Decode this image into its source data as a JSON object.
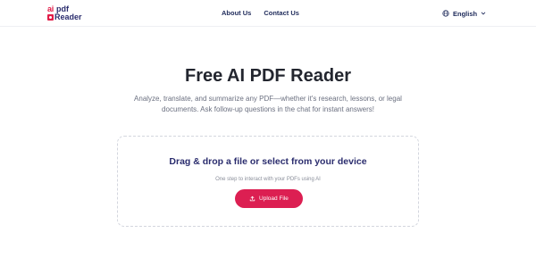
{
  "header": {
    "logo": {
      "ai": "ai",
      "pdf": "pdf",
      "reader": "Reader"
    },
    "nav": [
      {
        "label": "About Us"
      },
      {
        "label": "Contact Us"
      }
    ],
    "language": {
      "label": "English",
      "icon": "globe-icon",
      "chevron": "chevron-down-icon"
    }
  },
  "hero": {
    "title": "Free AI PDF Reader",
    "subtitle": "Analyze, translate, and summarize any PDF—whether it's research, lessons, or legal documents. Ask follow-up questions in the chat for instant answers!"
  },
  "dropzone": {
    "title": "Drag & drop a file or select from your device",
    "subtitle": "One step to interact with your PDFs using AI",
    "button_label": "Upload File",
    "button_icon": "upload-icon"
  },
  "colors": {
    "brand_red": "#dc1f52",
    "brand_navy": "#2b2d6e",
    "title_text": "#23262f",
    "muted_text": "#6b7080"
  }
}
